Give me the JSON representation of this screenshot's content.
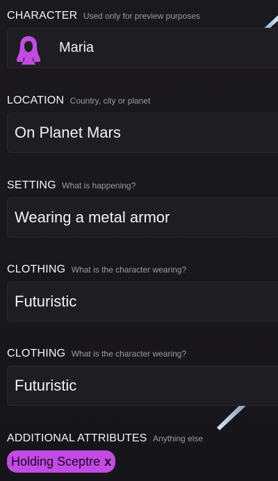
{
  "character": {
    "label": "CHARACTER",
    "hint": "Used only for preview purposes",
    "name": "Maria",
    "avatar_icon": "woman-silhouette-icon",
    "avatar_color": "#c34be4"
  },
  "location": {
    "label": "LOCATION",
    "hint": "Country, city or planet",
    "value": "On Planet Mars"
  },
  "setting": {
    "label": "SETTING",
    "hint": "What is happening?",
    "value": "Wearing a metal armor"
  },
  "clothing_1": {
    "label": "CLOTHING",
    "hint": "What is the character wearing?",
    "value": "Futuristic"
  },
  "clothing_2": {
    "label": "CLOTHING",
    "hint": "What is the character wearing?",
    "value": "Futuristic"
  },
  "additional": {
    "label": "ADDITIONAL ATTRIBUTES",
    "hint": "Anything else",
    "tags": [
      {
        "label": "Holding Sceptre",
        "remove": "x"
      }
    ],
    "tag_color": "#c34be4"
  }
}
